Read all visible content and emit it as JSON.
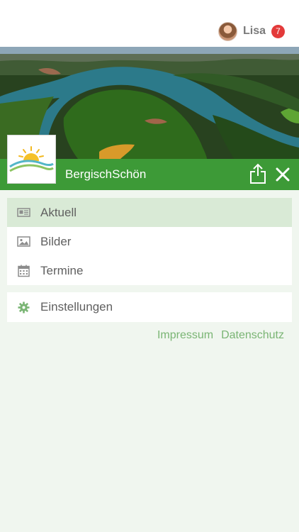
{
  "user": {
    "name": "Lisa",
    "notification_count": "7",
    "avatar_icon": "user-avatar"
  },
  "app": {
    "title": "BergischSchön",
    "brand_color": "#3d9a37",
    "active_color": "#d9ead6"
  },
  "header": {
    "share_icon": "share-icon",
    "close_icon": "close-icon"
  },
  "menu": {
    "items": [
      {
        "label": "Aktuell",
        "icon": "newspaper-icon",
        "active": true
      },
      {
        "label": "Bilder",
        "icon": "image-icon",
        "active": false
      },
      {
        "label": "Termine",
        "icon": "calendar-icon",
        "active": false
      }
    ]
  },
  "settings": {
    "label": "Einstellungen",
    "icon": "gear-icon"
  },
  "footer_links": {
    "impressum": "Impressum",
    "datenschutz": "Datenschutz"
  }
}
